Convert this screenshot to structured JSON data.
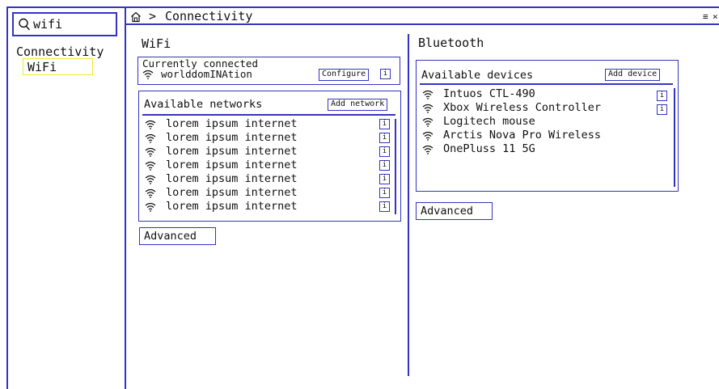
{
  "search": {
    "value": "wifi"
  },
  "sidebar": {
    "heading": "Connectivity",
    "selected": "WiFi"
  },
  "header": {
    "home_icon": "home-icon",
    "separator": ">",
    "title": "Connectivity",
    "menu_icon": "≡",
    "close_icon": "×"
  },
  "wifi": {
    "heading": "WiFi",
    "current": {
      "label": "Currently connected",
      "network": "worlddomINAtion",
      "configure": "Configure",
      "info": "i"
    },
    "available": {
      "label": "Available networks",
      "add": "Add network",
      "networks": [
        "lorem ipsum internet",
        "lorem ipsum internet",
        "lorem ipsum internet",
        "lorem ipsum internet",
        "lorem ipsum internet",
        "lorem ipsum internet",
        "lorem ipsum internet"
      ],
      "info": "i"
    },
    "advanced": "Advanced"
  },
  "bluetooth": {
    "heading": "Bluetooth",
    "label": "Available devices",
    "add": "Add device",
    "devices": [
      "Intuos CTL-490",
      "Xbox Wireless Controller",
      "Logitech mouse",
      "Arctis Nova Pro Wireless",
      "OnePluss 11 5G"
    ],
    "info": "i",
    "advanced": "Advanced"
  },
  "colors": {
    "accent": "#3434c0",
    "highlight": "#f2e832"
  }
}
